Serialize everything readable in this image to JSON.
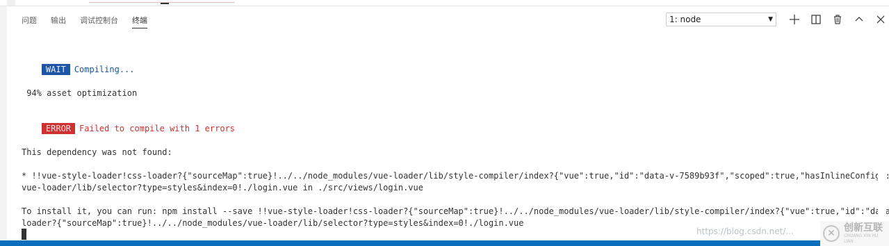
{
  "panel": {
    "tabs": [
      {
        "label": "问题"
      },
      {
        "label": "输出"
      },
      {
        "label": "调试控制台"
      },
      {
        "label": "终端"
      }
    ],
    "active_tab": "终端",
    "terminal_select": {
      "value": "1: node"
    },
    "actions": [
      "plus-icon",
      "split-icon",
      "trash-icon",
      "chevron-up-icon",
      "close-icon"
    ]
  },
  "terminal": {
    "wait_badge": "WAIT",
    "wait_text": "Compiling...",
    "progress_text": " 94% asset optimization",
    "error_badge": "ERROR",
    "error_text": "Failed to compile with 1 errors",
    "dep_not_found": "This dependency was not found:",
    "dep_line1": "* !!vue-style-loader!css-loader?{\"sourceMap\":true}!../../node_modules/vue-loader/lib/style-compiler/index?{\"vue\":true,\"id\":\"data-v-7589b93f\",\"scoped\":true,\"hasInlineConfig\":fal",
    "dep_line2": "vue-loader/lib/selector?type=styles&index=0!./login.vue in ./src/views/login.vue",
    "install_line1": "To install it, you can run: npm install --save !!vue-style-loader!css-loader?{\"sourceMap\":true}!../../node_modules/vue-loader/lib/style-compiler/index?{\"vue\":true,\"id\":\"data-v-",
    "install_line2": "loader?{\"sourceMap\":true}!../../node_modules/vue-loader/lib/selector?type=styles&index=0!./login.vue"
  },
  "watermark": "https://blog.csdn.net/...",
  "logo": {
    "name": "创新互联",
    "sub": "CHUANG XIN HU LIAN"
  },
  "colors": {
    "accent": "#0a6ebd",
    "wait": "#1e55a7",
    "error": "#cd3131"
  }
}
